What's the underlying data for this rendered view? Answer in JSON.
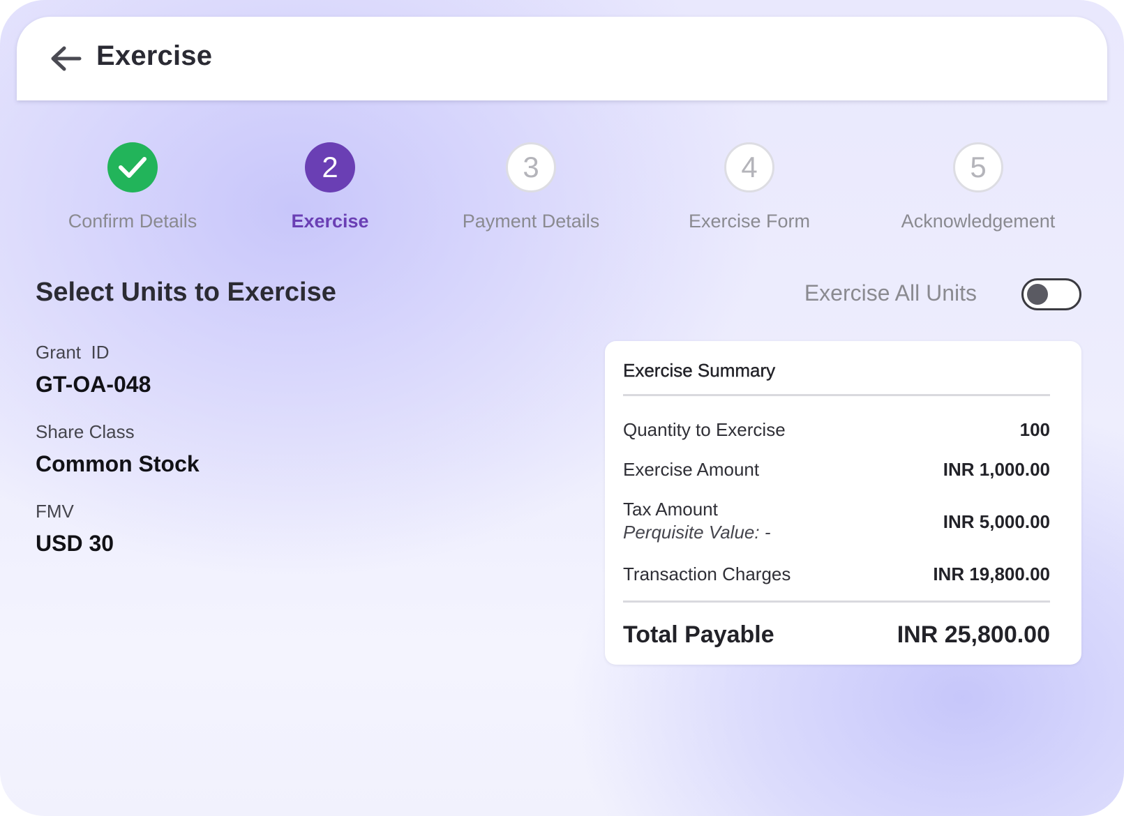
{
  "header": {
    "title": "Exercise",
    "back_icon": "arrow-left-icon"
  },
  "stepper": {
    "steps": [
      {
        "label": "Confirm Details",
        "number": "1",
        "state": "completed",
        "icon": "check-icon"
      },
      {
        "label": "Exercise",
        "number": "2",
        "state": "active"
      },
      {
        "label": "Payment Details",
        "number": "3",
        "state": "pending"
      },
      {
        "label": "Exercise Form",
        "number": "4",
        "state": "pending"
      },
      {
        "label": "Acknowledgement",
        "number": "5",
        "state": "pending"
      }
    ]
  },
  "section": {
    "title": "Select Units to Exercise",
    "toggle_label": "Exercise All Units",
    "toggle_on": false
  },
  "details": {
    "grant_id_label": "Grant  ID",
    "grant_id_value": "GT-OA-048",
    "share_class_label": "Share Class",
    "share_class_value": "Common Stock",
    "fmv_label": "FMV",
    "fmv_value": "USD 30"
  },
  "summary": {
    "title": "Exercise Summary",
    "rows": [
      {
        "label": "Quantity to Exercise",
        "value": "100"
      },
      {
        "label": "Exercise Amount",
        "value": "INR 1,000.00"
      },
      {
        "label": "Tax Amount",
        "sublabel": "Perquisite Value: -",
        "value": "INR 5,000.00"
      },
      {
        "label": "Transaction Charges",
        "value": "INR 19,800.00"
      }
    ],
    "total_label": "Total Payable",
    "total_value": "INR 25,800.00"
  },
  "colors": {
    "accent": "#6a3fb4",
    "success": "#22b45a",
    "pending_border": "#dddde3"
  }
}
